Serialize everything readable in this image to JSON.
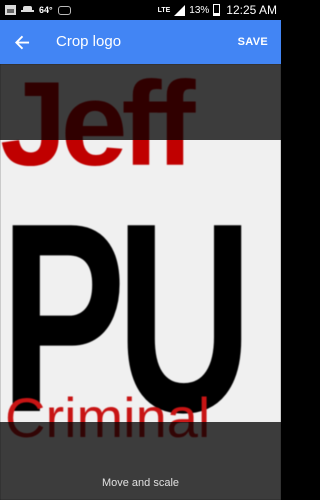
{
  "status_bar": {
    "temperature": "64°",
    "network": "LTE",
    "battery": "13%",
    "time": "12:25 AM",
    "icons": [
      "photo-icon",
      "spy-icon",
      "cloud-icon",
      "signal-icon",
      "battery-icon"
    ]
  },
  "app_bar": {
    "title": "Crop logo",
    "save_label": "SAVE",
    "back_icon": "arrow-back-icon",
    "color": "#4285f4"
  },
  "logo": {
    "line1": "Jeff",
    "line2": "PU",
    "line3": "Criminal",
    "red": "#c00000",
    "black": "#000000"
  },
  "hint": "Move and scale"
}
